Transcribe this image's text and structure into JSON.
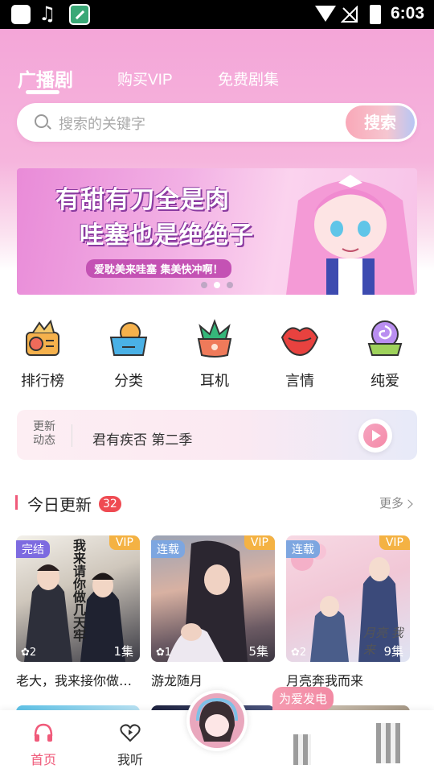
{
  "status_bar": {
    "time": "6:03"
  },
  "tabs": [
    {
      "label": "广播剧",
      "active": true
    },
    {
      "label": "购买VIP",
      "active": false
    },
    {
      "label": "免费剧集",
      "active": false
    }
  ],
  "search": {
    "placeholder": "搜索的关键字",
    "button": "搜索"
  },
  "banner": {
    "line1": "有甜有刀全是肉",
    "line2": "哇塞也是绝绝子",
    "sub": "爱耽美来哇塞 集美快冲啊！",
    "page_count": 3,
    "active_page": 2
  },
  "categories": [
    {
      "label": "排行榜",
      "icon": "radio-icon"
    },
    {
      "label": "分类",
      "icon": "category-box-icon"
    },
    {
      "label": "耳机",
      "icon": "succulent-icon"
    },
    {
      "label": "言情",
      "icon": "lips-icon"
    },
    {
      "label": "纯爱",
      "icon": "lollipop-icon"
    }
  ],
  "news": {
    "tag": "更新动态",
    "text": "君有疾否 第二季"
  },
  "today": {
    "title": "今日更新",
    "count": "32",
    "more": "更多",
    "items": [
      {
        "status": "完结",
        "vip": "VIP",
        "rank": "2",
        "episodes": "1集",
        "title": "老大，我来接你做…",
        "cover_text": "我来请你做几天牢"
      },
      {
        "status": "连载",
        "vip": "VIP",
        "rank": "1",
        "episodes": "5集",
        "title": "游龙随月"
      },
      {
        "status": "连载",
        "vip": "VIP",
        "rank": "2",
        "episodes": "9集",
        "title": "月亮奔我而来",
        "cover_text": "月亮 我来"
      }
    ]
  },
  "bottom_nav": {
    "items": [
      {
        "label": "首页",
        "active": true
      },
      {
        "label": "我听",
        "active": false
      }
    ],
    "bubble": "为爱发电"
  },
  "colors": {
    "accent": "#f05a7a",
    "header_pink": "#f4a6d8",
    "vip": "#f4b243",
    "status": "#7d6be0"
  }
}
